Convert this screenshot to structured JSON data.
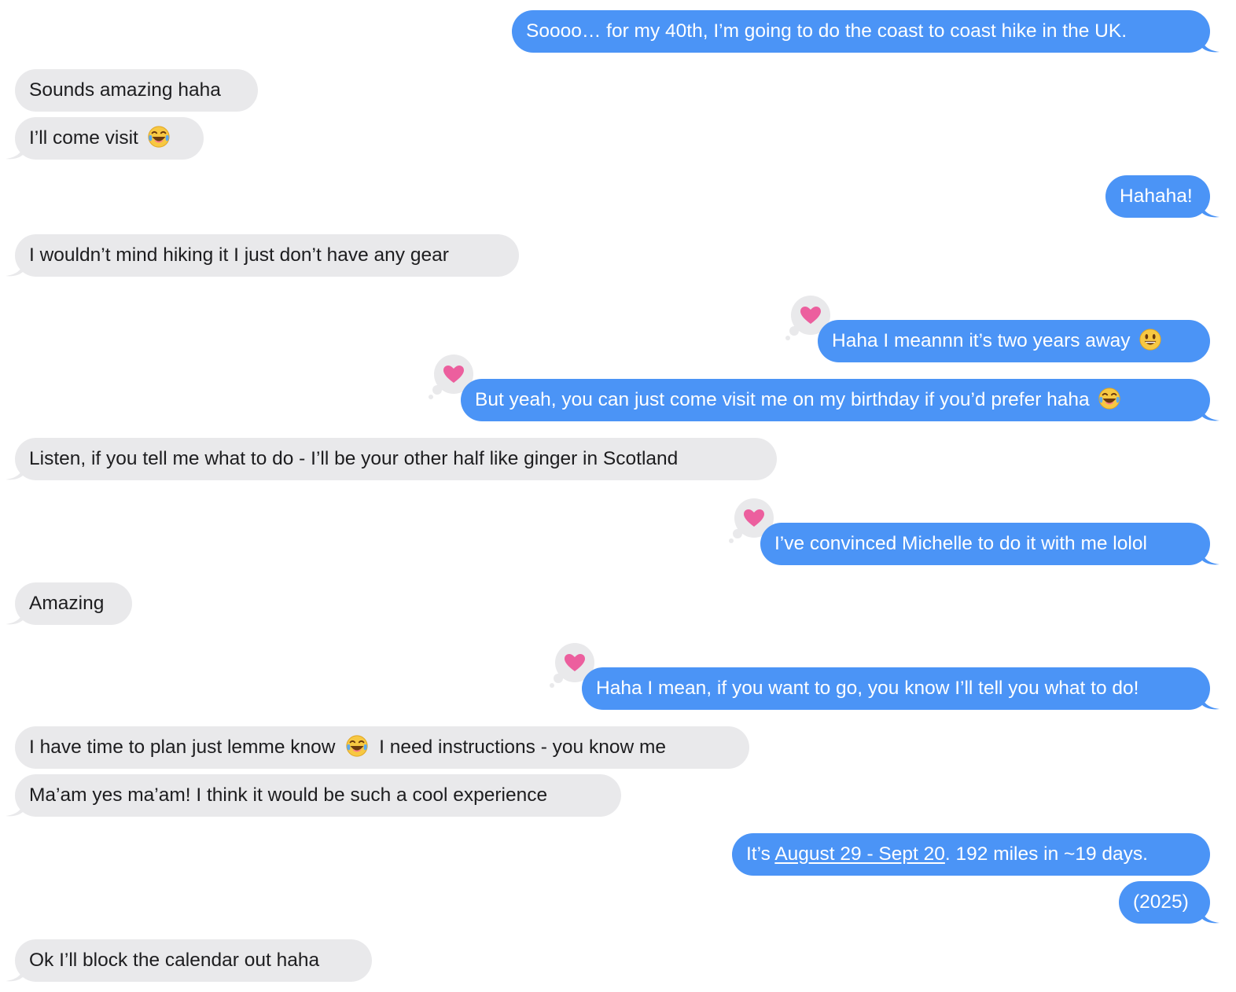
{
  "colors": {
    "outgoing_bubble": "#4b94f6",
    "incoming_bubble": "#e9e9eb",
    "tapback_heart": "#ec5f9e"
  },
  "messages": [
    {
      "id": "m1",
      "direction": "outgoing",
      "text": "Soooo… for my 40th, I’m going to do the coast to coast hike in the UK."
    },
    {
      "id": "m2",
      "direction": "incoming",
      "text": "Sounds amazing haha"
    },
    {
      "id": "m3",
      "direction": "incoming",
      "text": "I’ll come visit",
      "emoji": "tears-of-joy-emoji"
    },
    {
      "id": "m4",
      "direction": "outgoing",
      "text": "Hahaha!"
    },
    {
      "id": "m5",
      "direction": "incoming",
      "text": "I wouldn’t mind hiking it I just don’t have any gear"
    },
    {
      "id": "m6",
      "direction": "outgoing",
      "text": "Haha I meannn it’s two years away",
      "emoji": "smiley-emoji",
      "tapback": "heart-icon"
    },
    {
      "id": "m7",
      "direction": "outgoing",
      "text": "But yeah, you can just come visit me on my birthday if you’d prefer haha",
      "emoji": "tears-of-joy-emoji",
      "tapback": "heart-icon"
    },
    {
      "id": "m8",
      "direction": "incoming",
      "text": "Listen, if you tell me what to do - I’ll be your other half like ginger in Scotland"
    },
    {
      "id": "m9",
      "direction": "outgoing",
      "text": "I’ve convinced Michelle to do it with me lolol",
      "tapback": "heart-icon"
    },
    {
      "id": "m10",
      "direction": "incoming",
      "text": "Amazing"
    },
    {
      "id": "m11",
      "direction": "outgoing",
      "text": "Haha I mean, if you want to go, you know I’ll tell you what to do!",
      "tapback": "heart-icon"
    },
    {
      "id": "m12",
      "direction": "incoming",
      "text_before": "I have time to plan just lemme know",
      "emoji": "tears-of-joy-emoji",
      "text_after": "I need instructions - you know me"
    },
    {
      "id": "m13",
      "direction": "incoming",
      "text": "Ma’am yes ma’am! I think it would be such a cool experience"
    },
    {
      "id": "m14",
      "direction": "outgoing",
      "text_before": "It’s ",
      "link": "August 29 - Sept 20",
      "text_after": ". 192 miles in ~19 days."
    },
    {
      "id": "m15",
      "direction": "outgoing",
      "text": "(2025)"
    },
    {
      "id": "m16",
      "direction": "incoming",
      "text": "Ok I’ll block the calendar out haha"
    }
  ]
}
